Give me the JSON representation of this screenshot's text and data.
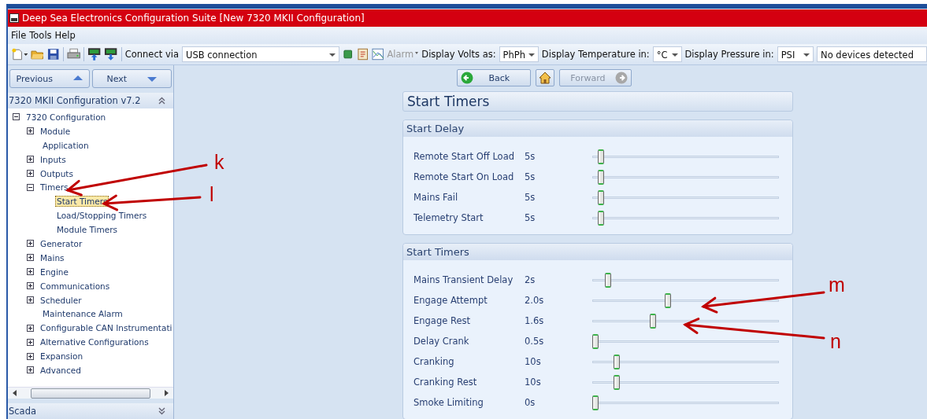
{
  "window": {
    "title": "Deep Sea Electronics Configuration Suite [New 7320 MKII Configuration]"
  },
  "menu": [
    "File",
    "Tools",
    "Help"
  ],
  "toolbar": {
    "connect_label": "Connect via",
    "connection": "USB connection",
    "alarm": {
      "label": "Alarm",
      "disabled": true
    },
    "volts_label": "Display Volts as:",
    "volts": "PhPh",
    "temp_label": "Display Temperature in:",
    "temp": "°C",
    "pressure_label": "Display Pressure in:",
    "pressure": "PSI",
    "status": "No devices detected"
  },
  "nav": {
    "previous": "Previous",
    "next": "Next",
    "back": {
      "label": "Back",
      "disabled": false
    },
    "forward": {
      "label": "Forward",
      "disabled": true
    }
  },
  "sidebar": {
    "title": "7320 MKII Configuration v7.2",
    "footer": "Scada",
    "tree": [
      {
        "label": "7320 Configuration",
        "kind": "folder",
        "expanded": true,
        "selected": false,
        "children": [
          {
            "label": "Module",
            "kind": "folder",
            "expanded": false,
            "selected": false
          },
          {
            "label": "Application",
            "kind": "page",
            "selected": false
          },
          {
            "label": "Inputs",
            "kind": "folder",
            "expanded": false,
            "selected": false
          },
          {
            "label": "Outputs",
            "kind": "folder",
            "expanded": false,
            "selected": false
          },
          {
            "label": "Timers",
            "kind": "folder",
            "expanded": true,
            "selected": false,
            "children": [
              {
                "label": "Start Timers",
                "kind": "page",
                "selected": true
              },
              {
                "label": "Load/Stopping Timers",
                "kind": "page",
                "selected": false
              },
              {
                "label": "Module Timers",
                "kind": "page",
                "selected": false
              }
            ]
          },
          {
            "label": "Generator",
            "kind": "folder",
            "expanded": false,
            "selected": false
          },
          {
            "label": "Mains",
            "kind": "folder",
            "expanded": false,
            "selected": false
          },
          {
            "label": "Engine",
            "kind": "folder",
            "expanded": false,
            "selected": false
          },
          {
            "label": "Communications",
            "kind": "folder",
            "expanded": false,
            "selected": false
          },
          {
            "label": "Scheduler",
            "kind": "folder",
            "expanded": false,
            "selected": false
          },
          {
            "label": "Maintenance Alarm",
            "kind": "page",
            "selected": false
          },
          {
            "label": "Configurable CAN Instrumentati",
            "kind": "folder",
            "expanded": false,
            "selected": false
          },
          {
            "label": "Alternative Configurations",
            "kind": "folder",
            "expanded": false,
            "selected": false
          },
          {
            "label": "Expansion",
            "kind": "folder",
            "expanded": false,
            "selected": false
          },
          {
            "label": "Advanced",
            "kind": "folder",
            "expanded": false,
            "selected": false
          }
        ]
      }
    ]
  },
  "page": {
    "title": "Start Timers",
    "sections": [
      {
        "title": "Start Delay",
        "rows": [
          {
            "name": "Remote Start Off Load",
            "reading": "5s",
            "level": 0.03
          },
          {
            "name": "Remote Start On Load",
            "reading": "5s",
            "level": 0.03
          },
          {
            "name": "Mains Fail",
            "reading": "5s",
            "level": 0.03
          },
          {
            "name": "Telemetry Start",
            "reading": "5s",
            "level": 0.03
          }
        ]
      },
      {
        "title": "Start Timers",
        "rows": [
          {
            "name": "Mains Transient Delay",
            "reading": "2s",
            "level": 0.07
          },
          {
            "name": "Engage Attempt",
            "reading": "2.0s",
            "level": 0.4
          },
          {
            "name": "Engage Rest",
            "reading": "1.6s",
            "level": 0.32
          },
          {
            "name": "Delay Crank",
            "reading": "0.5s",
            "level": 0
          },
          {
            "name": "Cranking",
            "reading": "10s",
            "level": 0.12
          },
          {
            "name": "Cranking Rest",
            "reading": "10s",
            "level": 0.12
          },
          {
            "name": "Smoke Limiting",
            "reading": "0s",
            "level": 0
          }
        ]
      }
    ]
  },
  "annotations": [
    {
      "label": "k"
    },
    {
      "label": "l"
    },
    {
      "label": "m"
    },
    {
      "label": "n"
    }
  ]
}
